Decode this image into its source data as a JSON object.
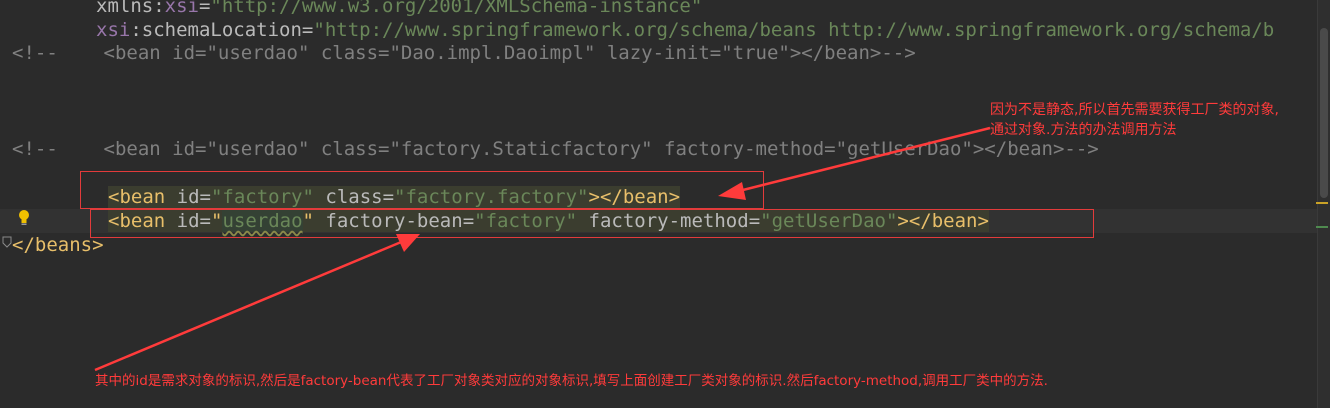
{
  "editor": {
    "lines": {
      "xmlns_xsi": {
        "prefix": "xmlns:",
        "ns": "xsi",
        "eq": "=",
        "value": "\"http://www.w3.org/2001/XMLSchema-instance\""
      },
      "schema_location": {
        "ns": "xsi",
        "attr": ":schemaLocation",
        "eq": "=",
        "value": "\"http://www.springframework.org/schema/beans http://www.springframework.org/schema/b"
      },
      "comment_1": "<!--    <bean id=\"userdao\" class=\"Dao.impl.Daoimpl\" lazy-init=\"true\"></bean>-->",
      "comment_2": "<!--    <bean id=\"userdao\" class=\"factory.Staticfactory\" factory-method=\"getUserDao\"></bean>-->",
      "bean_factory": {
        "open_tag": "<bean",
        "attr_id": " id",
        "eq1": "=",
        "id_value": "\"factory\"",
        "attr_class": " class",
        "eq2": "=",
        "class_value": "\"factory.factory\"",
        "close_tag": "></bean>"
      },
      "bean_userdao": {
        "open_tag": "<bean",
        "attr_id": " id",
        "eq1": "=",
        "id_quote_open": "\"",
        "id_value": "userdao",
        "id_quote_close": "\"",
        "attr_factory_bean": " factory-bean",
        "eq2": "=",
        "factory_bean_value": "\"factory\"",
        "attr_factory_method": " factory-method",
        "eq3": "=",
        "factory_method_value": "\"getUserDao\"",
        "close_tag": "></bean>"
      },
      "beans_close": "</beans>"
    }
  },
  "annotations": {
    "top_right_line1": "因为不是静态,所以首先需要获得工厂类的对象,",
    "top_right_line2": "通过对象.方法的办法调用方法",
    "bottom": "其中的id是需求对象的标识,然后是factory-bean代表了工厂对象类对应的对象标识,填写上面创建工厂类对象的标识.然后factory-method,调用工厂类中的方法."
  },
  "colors": {
    "background": "#2b2b2b",
    "tag": "#e8bf6a",
    "attribute": "#bababa",
    "namespace": "#9876aa",
    "string": "#6a8759",
    "comment": "#808080",
    "annotation": "#ff3b3b",
    "bulb": "#f0c000",
    "marker_warning": "#c9a227",
    "marker_ok": "#4f8a4f"
  },
  "icons": {
    "gutter": "lightbulb-icon",
    "fold": "fold-end-icon"
  }
}
